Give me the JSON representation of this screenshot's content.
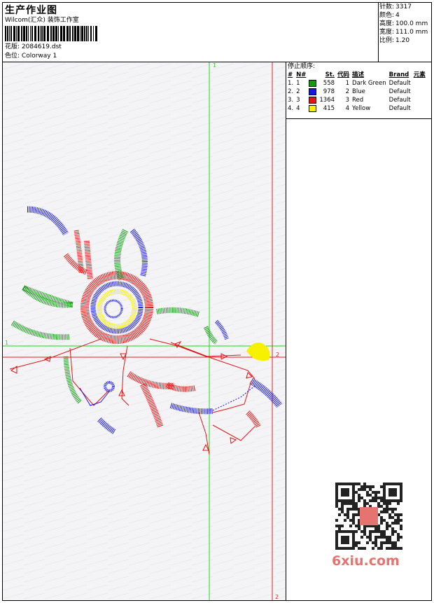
{
  "header": {
    "title": "生产作业图",
    "subtitle": "Wilcom(汇众) 装饰工作室",
    "pattern_label": "花版:",
    "pattern_value": "2084619.dst",
    "colorway_label": "色位:",
    "colorway_value": "Colorway 1"
  },
  "stats": [
    {
      "label": "针数:",
      "value": "3317"
    },
    {
      "label": "颜色:",
      "value": "4"
    },
    {
      "label": "高度:",
      "value": "100.0 mm"
    },
    {
      "label": "宽度:",
      "value": "111.0 mm"
    },
    {
      "label": "比例:",
      "value": "1.20"
    }
  ],
  "stop_sequence": {
    "title": "停止顺序:",
    "headers": {
      "idx": "#",
      "no": "N#",
      "stitches": "St.",
      "code": "代码",
      "desc": "描述",
      "brand": "Brand",
      "element": "元素"
    },
    "rows": [
      {
        "idx": "1.",
        "no": "1",
        "color": "#129812",
        "stitches": "558",
        "code": "1",
        "desc": "Dark Green",
        "brand": "Default"
      },
      {
        "idx": "2.",
        "no": "2",
        "color": "#1616e0",
        "stitches": "978",
        "code": "2",
        "desc": "Blue",
        "brand": "Default"
      },
      {
        "idx": "3.",
        "no": "3",
        "color": "#e01414",
        "stitches": "1364",
        "code": "3",
        "desc": "Red",
        "brand": "Default"
      },
      {
        "idx": "4.",
        "no": "4",
        "color": "#f7f000",
        "stitches": "415",
        "code": "4",
        "desc": "Yellow",
        "brand": "Default"
      }
    ]
  },
  "canvas": {
    "axis_markers": {
      "v1_top": "1",
      "h1_left": "1",
      "h2_right": "2",
      "v2_bottom": "2"
    },
    "guide_colors": {
      "green": "#1ed81e",
      "red": "#e02020"
    }
  },
  "watermark": "6xiu.com"
}
